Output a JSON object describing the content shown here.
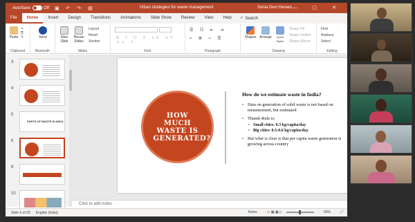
{
  "window": {
    "autosave_label": "AutoSave",
    "autosave_state": "Off",
    "doc_title": "Urban strategies for waste management",
    "user_name": "Sonia Devi Henam"
  },
  "tabs": [
    "File",
    "Home",
    "Insert",
    "Design",
    "Transitions",
    "Animations",
    "Slide Show",
    "Review",
    "View",
    "Help"
  ],
  "active_tab": "Home",
  "search_label": "Search",
  "ribbon": {
    "clipboard": {
      "paste": "Paste",
      "label": "Clipboard"
    },
    "bluetooth": {
      "send": "Send",
      "label": "Bluetooth"
    },
    "slides": {
      "new_slide": "New Slide",
      "reuse_slides": "Reuse Slides",
      "layout": "Layout",
      "reset": "Reset",
      "section": "Section",
      "label": "Slides"
    },
    "font": {
      "label": "Font"
    },
    "paragraph": {
      "label": "Paragraph"
    },
    "drawing": {
      "shapes": "Shapes",
      "arrange": "Arrange",
      "quick_styles": "Quick Styles",
      "shape_fill": "Shape Fill",
      "shape_outline": "Shape Outline",
      "shape_effects": "Shape Effects",
      "label": "Drawing"
    },
    "editing": {
      "find": "Find",
      "replace": "Replace",
      "select": "Select",
      "label": "Editing"
    }
  },
  "thumbnails": [
    {
      "num": "3",
      "kind": "circle-text"
    },
    {
      "num": "4",
      "kind": "circle-text"
    },
    {
      "num": "5",
      "kind": "title",
      "text": "PARTS OF WASTE IN INDIA"
    },
    {
      "num": "6",
      "kind": "circle-text",
      "selected": true
    },
    {
      "num": "8",
      "kind": "bar"
    },
    {
      "num": "10",
      "kind": "chart"
    }
  ],
  "slide": {
    "circle_title": "HOW MUCH WASTE IS GENERATED?",
    "heading": "How do we estimate waste in India?",
    "bullet1": "Data on generation of solid waste is not based on measurement, but estimated",
    "bullet2": "Thumb-Rule is:",
    "sub1": "Small cities: 0.3 kg/capita/day",
    "sub2": "Big cities: 0.5-0.6 kg/capita/day",
    "bullet3": "But what is clear is that per capita waste generation is growing across country"
  },
  "notes_placeholder": "Click to add notes",
  "status": {
    "slide_info": "Slide 6 of 25",
    "language": "English (India)",
    "notes": "Notes",
    "zoom": "69%"
  },
  "colors": {
    "accent": "#b7472a",
    "circle": "#c4461f"
  }
}
